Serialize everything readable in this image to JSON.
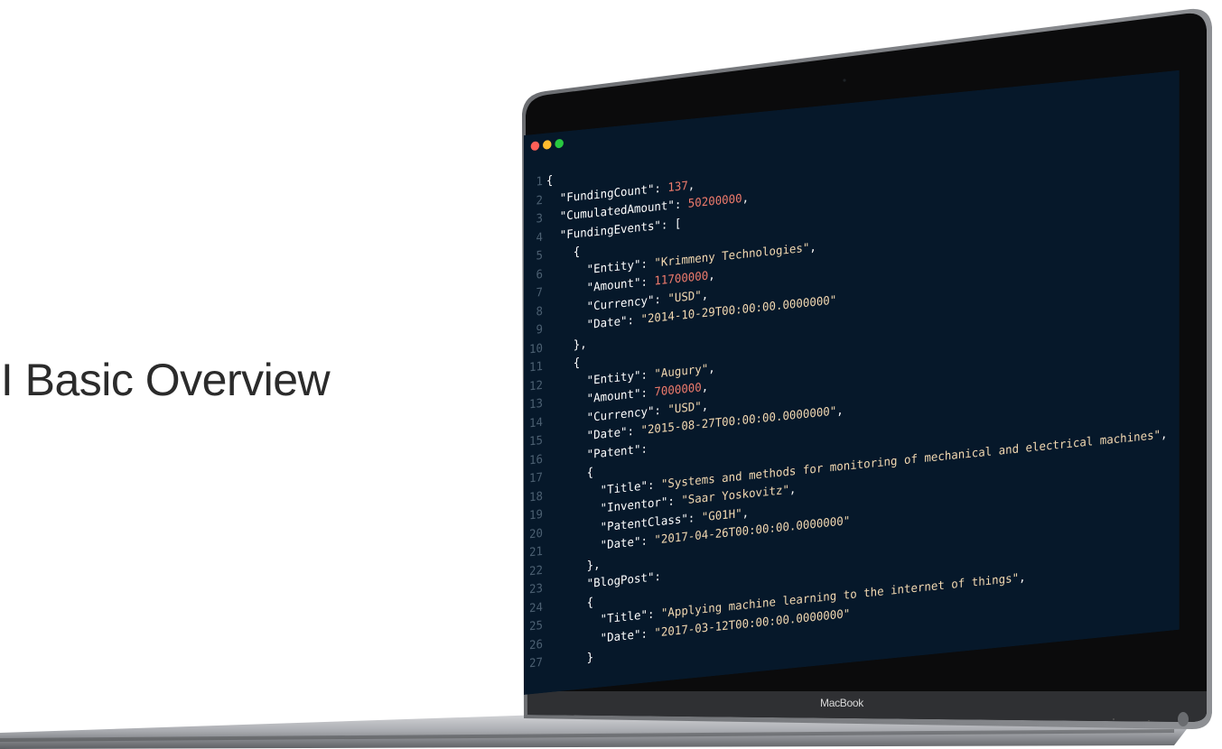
{
  "headline": "PI Basic Overview",
  "device_label": "MacBook",
  "window_controls": [
    "close-dot",
    "minimize-dot",
    "zoom-dot"
  ],
  "code_lines": [
    [
      {
        "t": "punc",
        "v": "{"
      }
    ],
    [
      {
        "t": "key",
        "v": "  \"FundingCount\""
      },
      {
        "t": "punc",
        "v": ": "
      },
      {
        "t": "num",
        "v": "137"
      },
      {
        "t": "punc",
        "v": ","
      }
    ],
    [
      {
        "t": "key",
        "v": "  \"CumulatedAmount\""
      },
      {
        "t": "punc",
        "v": ": "
      },
      {
        "t": "num",
        "v": "50200000"
      },
      {
        "t": "punc",
        "v": ","
      }
    ],
    [
      {
        "t": "key",
        "v": "  \"FundingEvents\""
      },
      {
        "t": "punc",
        "v": ": ["
      }
    ],
    [
      {
        "t": "punc",
        "v": "    {"
      }
    ],
    [
      {
        "t": "key",
        "v": "      \"Entity\""
      },
      {
        "t": "punc",
        "v": ": "
      },
      {
        "t": "str",
        "v": "\"Krimmeny Technologies\""
      },
      {
        "t": "punc",
        "v": ","
      }
    ],
    [
      {
        "t": "key",
        "v": "      \"Amount\""
      },
      {
        "t": "punc",
        "v": ": "
      },
      {
        "t": "num",
        "v": "11700000"
      },
      {
        "t": "punc",
        "v": ","
      }
    ],
    [
      {
        "t": "key",
        "v": "      \"Currency\""
      },
      {
        "t": "punc",
        "v": ": "
      },
      {
        "t": "str",
        "v": "\"USD\""
      },
      {
        "t": "punc",
        "v": ","
      }
    ],
    [
      {
        "t": "key",
        "v": "      \"Date\""
      },
      {
        "t": "punc",
        "v": ": "
      },
      {
        "t": "str",
        "v": "\"2014-10-29T00:00:00.0000000\""
      }
    ],
    [
      {
        "t": "punc",
        "v": "    },"
      }
    ],
    [
      {
        "t": "punc",
        "v": "    {"
      }
    ],
    [
      {
        "t": "key",
        "v": "      \"Entity\""
      },
      {
        "t": "punc",
        "v": ": "
      },
      {
        "t": "str",
        "v": "\"Augury\""
      },
      {
        "t": "punc",
        "v": ","
      }
    ],
    [
      {
        "t": "key",
        "v": "      \"Amount\""
      },
      {
        "t": "punc",
        "v": ": "
      },
      {
        "t": "num",
        "v": "7000000"
      },
      {
        "t": "punc",
        "v": ","
      }
    ],
    [
      {
        "t": "key",
        "v": "      \"Currency\""
      },
      {
        "t": "punc",
        "v": ": "
      },
      {
        "t": "str",
        "v": "\"USD\""
      },
      {
        "t": "punc",
        "v": ","
      }
    ],
    [
      {
        "t": "key",
        "v": "      \"Date\""
      },
      {
        "t": "punc",
        "v": ": "
      },
      {
        "t": "str",
        "v": "\"2015-08-27T00:00:00.0000000\""
      },
      {
        "t": "punc",
        "v": ","
      }
    ],
    [
      {
        "t": "key",
        "v": "      \"Patent\""
      },
      {
        "t": "punc",
        "v": ":"
      }
    ],
    [
      {
        "t": "punc",
        "v": "      {"
      }
    ],
    [
      {
        "t": "key",
        "v": "        \"Title\""
      },
      {
        "t": "punc",
        "v": ": "
      },
      {
        "t": "str",
        "v": "\"Systems and methods for monitoring of mechanical and electrical machines\""
      },
      {
        "t": "punc",
        "v": ","
      }
    ],
    [
      {
        "t": "key",
        "v": "        \"Inventor\""
      },
      {
        "t": "punc",
        "v": ": "
      },
      {
        "t": "str",
        "v": "\"Saar Yoskovitz\""
      },
      {
        "t": "punc",
        "v": ","
      }
    ],
    [
      {
        "t": "key",
        "v": "        \"PatentClass\""
      },
      {
        "t": "punc",
        "v": ": "
      },
      {
        "t": "str",
        "v": "\"G01H\""
      },
      {
        "t": "punc",
        "v": ","
      }
    ],
    [
      {
        "t": "key",
        "v": "        \"Date\""
      },
      {
        "t": "punc",
        "v": ": "
      },
      {
        "t": "str",
        "v": "\"2017-04-26T00:00:00.0000000\""
      }
    ],
    [
      {
        "t": "punc",
        "v": "      },"
      }
    ],
    [
      {
        "t": "key",
        "v": "      \"BlogPost\""
      },
      {
        "t": "punc",
        "v": ":"
      }
    ],
    [
      {
        "t": "punc",
        "v": "      {"
      }
    ],
    [
      {
        "t": "key",
        "v": "        \"Title\""
      },
      {
        "t": "punc",
        "v": ": "
      },
      {
        "t": "str",
        "v": "\"Applying machine learning to the internet of things\""
      },
      {
        "t": "punc",
        "v": ","
      }
    ],
    [
      {
        "t": "key",
        "v": "        \"Date\""
      },
      {
        "t": "punc",
        "v": ": "
      },
      {
        "t": "str",
        "v": "\"2017-03-12T00:00:00.0000000\""
      }
    ],
    [
      {
        "t": "punc",
        "v": "      }"
      }
    ]
  ],
  "colors": {
    "screen_bg": "#06182a",
    "key": "#ffffff",
    "string": "#f3d9b1",
    "number": "#f07b6c",
    "line_number": "#4c6072"
  }
}
